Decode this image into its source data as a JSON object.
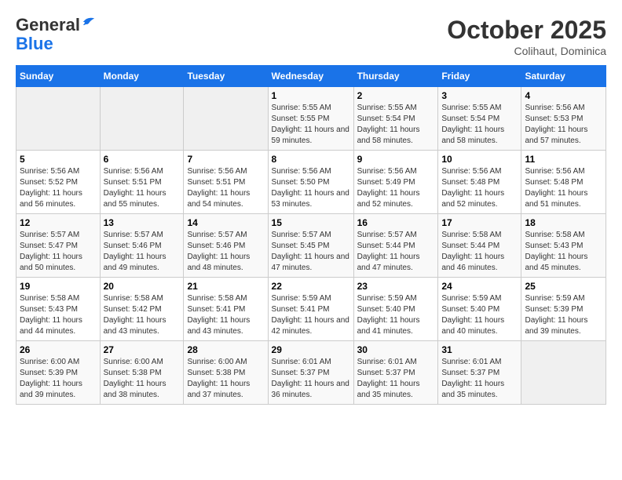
{
  "header": {
    "logo_line1": "General",
    "logo_line2": "Blue",
    "month": "October 2025",
    "location": "Colihaut, Dominica"
  },
  "weekdays": [
    "Sunday",
    "Monday",
    "Tuesday",
    "Wednesday",
    "Thursday",
    "Friday",
    "Saturday"
  ],
  "weeks": [
    [
      {
        "day": "",
        "info": ""
      },
      {
        "day": "",
        "info": ""
      },
      {
        "day": "",
        "info": ""
      },
      {
        "day": "1",
        "info": "Sunrise: 5:55 AM\nSunset: 5:55 PM\nDaylight: 11 hours and 59 minutes."
      },
      {
        "day": "2",
        "info": "Sunrise: 5:55 AM\nSunset: 5:54 PM\nDaylight: 11 hours and 58 minutes."
      },
      {
        "day": "3",
        "info": "Sunrise: 5:55 AM\nSunset: 5:54 PM\nDaylight: 11 hours and 58 minutes."
      },
      {
        "day": "4",
        "info": "Sunrise: 5:56 AM\nSunset: 5:53 PM\nDaylight: 11 hours and 57 minutes."
      }
    ],
    [
      {
        "day": "5",
        "info": "Sunrise: 5:56 AM\nSunset: 5:52 PM\nDaylight: 11 hours and 56 minutes."
      },
      {
        "day": "6",
        "info": "Sunrise: 5:56 AM\nSunset: 5:51 PM\nDaylight: 11 hours and 55 minutes."
      },
      {
        "day": "7",
        "info": "Sunrise: 5:56 AM\nSunset: 5:51 PM\nDaylight: 11 hours and 54 minutes."
      },
      {
        "day": "8",
        "info": "Sunrise: 5:56 AM\nSunset: 5:50 PM\nDaylight: 11 hours and 53 minutes."
      },
      {
        "day": "9",
        "info": "Sunrise: 5:56 AM\nSunset: 5:49 PM\nDaylight: 11 hours and 52 minutes."
      },
      {
        "day": "10",
        "info": "Sunrise: 5:56 AM\nSunset: 5:48 PM\nDaylight: 11 hours and 52 minutes."
      },
      {
        "day": "11",
        "info": "Sunrise: 5:56 AM\nSunset: 5:48 PM\nDaylight: 11 hours and 51 minutes."
      }
    ],
    [
      {
        "day": "12",
        "info": "Sunrise: 5:57 AM\nSunset: 5:47 PM\nDaylight: 11 hours and 50 minutes."
      },
      {
        "day": "13",
        "info": "Sunrise: 5:57 AM\nSunset: 5:46 PM\nDaylight: 11 hours and 49 minutes."
      },
      {
        "day": "14",
        "info": "Sunrise: 5:57 AM\nSunset: 5:46 PM\nDaylight: 11 hours and 48 minutes."
      },
      {
        "day": "15",
        "info": "Sunrise: 5:57 AM\nSunset: 5:45 PM\nDaylight: 11 hours and 47 minutes."
      },
      {
        "day": "16",
        "info": "Sunrise: 5:57 AM\nSunset: 5:44 PM\nDaylight: 11 hours and 47 minutes."
      },
      {
        "day": "17",
        "info": "Sunrise: 5:58 AM\nSunset: 5:44 PM\nDaylight: 11 hours and 46 minutes."
      },
      {
        "day": "18",
        "info": "Sunrise: 5:58 AM\nSunset: 5:43 PM\nDaylight: 11 hours and 45 minutes."
      }
    ],
    [
      {
        "day": "19",
        "info": "Sunrise: 5:58 AM\nSunset: 5:43 PM\nDaylight: 11 hours and 44 minutes."
      },
      {
        "day": "20",
        "info": "Sunrise: 5:58 AM\nSunset: 5:42 PM\nDaylight: 11 hours and 43 minutes."
      },
      {
        "day": "21",
        "info": "Sunrise: 5:58 AM\nSunset: 5:41 PM\nDaylight: 11 hours and 43 minutes."
      },
      {
        "day": "22",
        "info": "Sunrise: 5:59 AM\nSunset: 5:41 PM\nDaylight: 11 hours and 42 minutes."
      },
      {
        "day": "23",
        "info": "Sunrise: 5:59 AM\nSunset: 5:40 PM\nDaylight: 11 hours and 41 minutes."
      },
      {
        "day": "24",
        "info": "Sunrise: 5:59 AM\nSunset: 5:40 PM\nDaylight: 11 hours and 40 minutes."
      },
      {
        "day": "25",
        "info": "Sunrise: 5:59 AM\nSunset: 5:39 PM\nDaylight: 11 hours and 39 minutes."
      }
    ],
    [
      {
        "day": "26",
        "info": "Sunrise: 6:00 AM\nSunset: 5:39 PM\nDaylight: 11 hours and 39 minutes."
      },
      {
        "day": "27",
        "info": "Sunrise: 6:00 AM\nSunset: 5:38 PM\nDaylight: 11 hours and 38 minutes."
      },
      {
        "day": "28",
        "info": "Sunrise: 6:00 AM\nSunset: 5:38 PM\nDaylight: 11 hours and 37 minutes."
      },
      {
        "day": "29",
        "info": "Sunrise: 6:01 AM\nSunset: 5:37 PM\nDaylight: 11 hours and 36 minutes."
      },
      {
        "day": "30",
        "info": "Sunrise: 6:01 AM\nSunset: 5:37 PM\nDaylight: 11 hours and 35 minutes."
      },
      {
        "day": "31",
        "info": "Sunrise: 6:01 AM\nSunset: 5:37 PM\nDaylight: 11 hours and 35 minutes."
      },
      {
        "day": "",
        "info": ""
      }
    ]
  ]
}
